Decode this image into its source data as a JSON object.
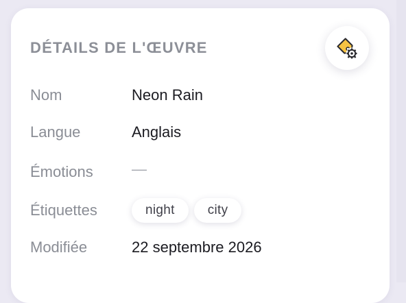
{
  "panel": {
    "title": "DÉTAILS DE L'ŒUVRE",
    "settings_button_icon": "tag-gear-icon"
  },
  "details": {
    "name": {
      "label": "Nom",
      "value": "Neon Rain"
    },
    "language": {
      "label": "Langue",
      "value": "Anglais"
    },
    "emotions": {
      "label": "Émotions",
      "value": "—"
    },
    "tags": {
      "label": "Étiquettes",
      "items": [
        "night",
        "city"
      ]
    },
    "modified": {
      "label": "Modifiée",
      "value": "22 septembre 2026"
    }
  },
  "colors": {
    "background": "#ebe9f3",
    "card": "#ffffff",
    "label_text": "#8a8d95",
    "value_text": "#1b1b21",
    "tag_icon_fill": "#f6c343"
  }
}
